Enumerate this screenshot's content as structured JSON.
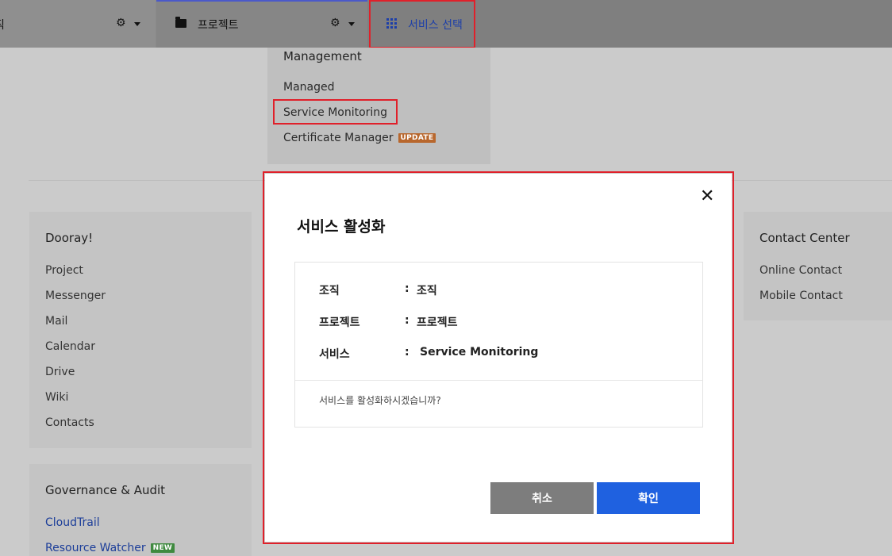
{
  "topbar": {
    "org_label": "직",
    "project_label": "프로젝트",
    "service_select_label": "서비스 선택"
  },
  "dropdown": {
    "title": "Management",
    "items": [
      {
        "label": "Managed"
      },
      {
        "label": "Service Monitoring"
      },
      {
        "label": "Certificate Manager",
        "badge": "UPDATE"
      }
    ]
  },
  "dooray": {
    "title": "Dooray!",
    "items": [
      "Project",
      "Messenger",
      "Mail",
      "Calendar",
      "Drive",
      "Wiki",
      "Contacts"
    ]
  },
  "governance": {
    "title": "Governance & Audit",
    "items": [
      {
        "label": "CloudTrail"
      },
      {
        "label": "Resource Watcher",
        "badge": "NEW"
      }
    ]
  },
  "contact_center": {
    "title": "Contact Center",
    "items": [
      "Online Contact",
      "Mobile Contact"
    ]
  },
  "modal": {
    "title": "서비스 활성화",
    "close_icon": "✕",
    "rows": [
      {
        "label": "조직",
        "colon": ":",
        "value": "조직"
      },
      {
        "label": "프로젝트",
        "colon": ":",
        "value": "프로젝트"
      },
      {
        "label": "서비스",
        "colon": ":",
        "value": "Service Monitoring"
      }
    ],
    "confirm_text": "서비스를 활성화하시겠습니까?",
    "cancel_label": "취소",
    "ok_label": "확인"
  },
  "icons": {
    "gear": "⚙",
    "folder": "folder-icon",
    "grid": "grid-icon"
  },
  "colors": {
    "highlight": "#e0202a",
    "primary": "#1f61e0",
    "link": "#1b3d99",
    "update_badge": "#b8672d",
    "new_badge": "#3f8a3f"
  }
}
